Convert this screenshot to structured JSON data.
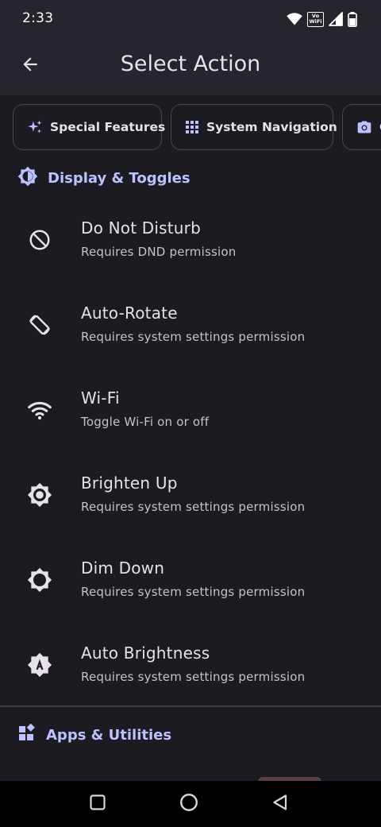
{
  "status_bar": {
    "time": "2:33",
    "vowifi_line1": "Vo",
    "vowifi_line2": "WiFi"
  },
  "app_bar": {
    "title": "Select Action"
  },
  "chips": [
    {
      "label": "Special Features",
      "icon": "sparkle-icon"
    },
    {
      "label": "System Navigation",
      "icon": "grid-icon"
    },
    {
      "label": "C",
      "icon": "camera-icon"
    }
  ],
  "sections": {
    "display": {
      "title": "Display & Toggles",
      "icon": "brightness-badge-icon"
    },
    "apps": {
      "title": "Apps & Utilities",
      "icon": "widgets-icon"
    }
  },
  "actions": [
    {
      "title": "Do Not Disturb",
      "subtitle": "Requires DND permission",
      "icon": "do-not-disturb-icon"
    },
    {
      "title": "Auto-Rotate",
      "subtitle": "Requires system settings permission",
      "icon": "screen-rotation-icon"
    },
    {
      "title": "Wi-Fi",
      "subtitle": "Toggle Wi-Fi on or off",
      "icon": "wifi-icon"
    },
    {
      "title": "Brighten Up",
      "subtitle": "Requires system settings permission",
      "icon": "brightness-high-icon"
    },
    {
      "title": "Dim Down",
      "subtitle": "Requires system settings permission",
      "icon": "brightness-low-icon"
    },
    {
      "title": "Auto Brightness",
      "subtitle": "Requires system settings permission",
      "icon": "brightness-auto-icon"
    }
  ],
  "colors": {
    "background": "#1b1b21",
    "top_bar": "#25252d",
    "accent": "#bcc2ff",
    "text_primary": "#e6e1ea",
    "text_secondary": "#c3c3cc",
    "outline": "#47464f"
  }
}
